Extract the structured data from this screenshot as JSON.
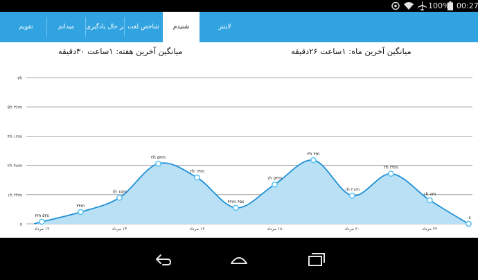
{
  "status_bar": {
    "battery_text": "100%",
    "clock": "00:27",
    "icons": [
      "notification-icon",
      "wifi-icon",
      "airplane-icon",
      "battery-icon"
    ]
  },
  "tabs": [
    {
      "label": "لایتنر",
      "active": false
    },
    {
      "label": "شنیدم",
      "active": true
    },
    {
      "label": "شاخص لغت",
      "active": false
    },
    {
      "label": "در حال یادگیری",
      "active": false
    },
    {
      "label": "میدانم",
      "active": false
    },
    {
      "label": "تقویم",
      "active": false
    }
  ],
  "averages": {
    "month": "میانگین آخرین ماه: ۱ساعت ۲۶دقیقه",
    "week": "میانگین آخرین هفته: ۱ساعت ۳۰دقیقه"
  },
  "colors": {
    "accent": "#30a3e0",
    "line": "#1e8fd6",
    "fill": "#b9e0f5",
    "grid": "#8a8a8a"
  },
  "chart_data": {
    "type": "area",
    "y_ticks": [
      {
        "label": "۰s",
        "value": 0
      },
      {
        "label": "۱h ۲۴m",
        "value": 84
      },
      {
        "label": "۲h ۴۸m",
        "value": 168
      },
      {
        "label": "۴h ۱۲m",
        "value": 252
      },
      {
        "label": "۵h ۳۶m",
        "value": 336
      },
      {
        "label": "۷h",
        "value": 420
      }
    ],
    "ylim": [
      0,
      420
    ],
    "x_ticks": [
      {
        "label": "۱۲ مرداد",
        "x": 12
      },
      {
        "label": "۱۴ مرداد",
        "x": 14
      },
      {
        "label": "۱۶ مرداد",
        "x": 16
      },
      {
        "label": "۱۸ مرداد",
        "x": 18
      },
      {
        "label": "۲۰ مرداد",
        "x": 20
      },
      {
        "label": "۲۲ مرداد",
        "x": 22
      }
    ],
    "xlim": [
      11.6,
      23.1
    ],
    "points": [
      {
        "x": 11.8,
        "y": 0,
        "label": ""
      },
      {
        "x": 12.0,
        "y": 6,
        "label": "۶m ۵۲s"
      },
      {
        "x": 13.0,
        "y": 34,
        "label": "۳۴m"
      },
      {
        "x": 14.0,
        "y": 75,
        "label": "۱h ۱۵m"
      },
      {
        "x": 15.0,
        "y": 173,
        "label": "۲h ۵۳m"
      },
      {
        "x": 16.0,
        "y": 133,
        "label": "۲h ۱۳m"
      },
      {
        "x": 17.0,
        "y": 46,
        "label": "۴۲m ۴۵s"
      },
      {
        "x": 18.0,
        "y": 113,
        "label": "۱h ۵۳m"
      },
      {
        "x": 19.0,
        "y": 183,
        "label": "۳h ۳m"
      },
      {
        "x": 20.0,
        "y": 81,
        "label": "۱h ۲۱m"
      },
      {
        "x": 21.0,
        "y": 144,
        "label": "۲h ۲۴m"
      },
      {
        "x": 22.0,
        "y": 68,
        "label": "۱h ۸m"
      },
      {
        "x": 23.0,
        "y": 0,
        "label": "۰s"
      }
    ],
    "grid": true
  },
  "nav_bar": {
    "buttons": [
      "back-icon",
      "home-icon",
      "recents-icon"
    ]
  }
}
